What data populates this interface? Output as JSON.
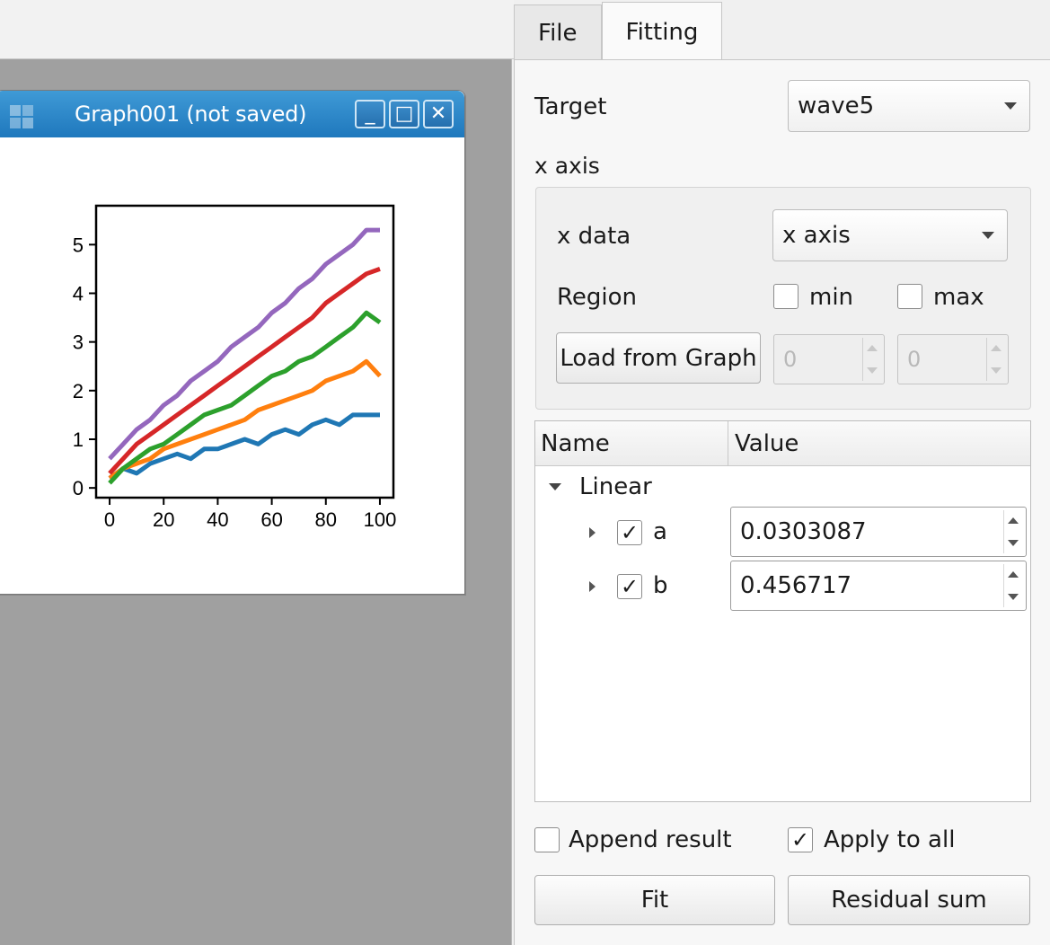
{
  "graph_window": {
    "title": "Graph001 (not saved)",
    "buttons": {
      "minimize": "_",
      "maximize": "□",
      "close": "✕"
    }
  },
  "chart_data": {
    "type": "line",
    "title": "",
    "xlabel": "",
    "ylabel": "",
    "xlim": [
      -5,
      105
    ],
    "ylim": [
      -0.2,
      5.8
    ],
    "x_ticks": [
      "0",
      "20",
      "40",
      "60",
      "80",
      "100"
    ],
    "y_ticks": [
      "0",
      "1",
      "2",
      "3",
      "4",
      "5"
    ],
    "grid": false,
    "x": [
      0,
      5,
      10,
      15,
      20,
      25,
      30,
      35,
      40,
      45,
      50,
      55,
      60,
      65,
      70,
      75,
      80,
      85,
      90,
      95,
      100
    ],
    "series": [
      {
        "color": "#1f77b4",
        "values": [
          0.2,
          0.4,
          0.3,
          0.5,
          0.6,
          0.7,
          0.6,
          0.8,
          0.8,
          0.9,
          1.0,
          0.9,
          1.1,
          1.2,
          1.1,
          1.3,
          1.4,
          1.3,
          1.5,
          1.5,
          1.5
        ]
      },
      {
        "color": "#ff7f0e",
        "values": [
          0.2,
          0.4,
          0.5,
          0.6,
          0.8,
          0.9,
          1.0,
          1.1,
          1.2,
          1.3,
          1.4,
          1.6,
          1.7,
          1.8,
          1.9,
          2.0,
          2.2,
          2.3,
          2.4,
          2.6,
          2.3
        ]
      },
      {
        "color": "#2ca02c",
        "values": [
          0.1,
          0.4,
          0.6,
          0.8,
          0.9,
          1.1,
          1.3,
          1.5,
          1.6,
          1.7,
          1.9,
          2.1,
          2.3,
          2.4,
          2.6,
          2.7,
          2.9,
          3.1,
          3.3,
          3.6,
          3.4
        ]
      },
      {
        "color": "#d62728",
        "values": [
          0.3,
          0.6,
          0.9,
          1.1,
          1.3,
          1.5,
          1.7,
          1.9,
          2.1,
          2.3,
          2.5,
          2.7,
          2.9,
          3.1,
          3.3,
          3.5,
          3.8,
          4.0,
          4.2,
          4.4,
          4.5
        ]
      },
      {
        "color": "#9467bd",
        "values": [
          0.6,
          0.9,
          1.2,
          1.4,
          1.7,
          1.9,
          2.2,
          2.4,
          2.6,
          2.9,
          3.1,
          3.3,
          3.6,
          3.8,
          4.1,
          4.3,
          4.6,
          4.8,
          5.0,
          5.3,
          5.3
        ]
      }
    ]
  },
  "tabs": [
    {
      "label": "File",
      "active": false
    },
    {
      "label": "Fitting",
      "active": true
    }
  ],
  "fitting": {
    "target_label": "Target",
    "target_value": "wave5",
    "x_axis_section": "x axis",
    "x_data_label": "x data",
    "x_data_value": "x axis",
    "region_label": "Region",
    "min_label": "min",
    "max_label": "max",
    "min_checked": false,
    "max_checked": false,
    "load_button": "Load from Graph",
    "region_min_value": "0",
    "region_max_value": "0",
    "tree_headers": {
      "name": "Name",
      "value": "Value"
    },
    "model_name": "Linear",
    "params": [
      {
        "name": "a",
        "checked": true,
        "value": "0.0303087"
      },
      {
        "name": "b",
        "checked": true,
        "value": "0.456717"
      }
    ],
    "append_result_label": "Append result",
    "append_result_checked": false,
    "apply_to_all_label": "Apply to all",
    "apply_to_all_checked": true,
    "fit_button": "Fit",
    "residual_button": "Residual sum"
  }
}
